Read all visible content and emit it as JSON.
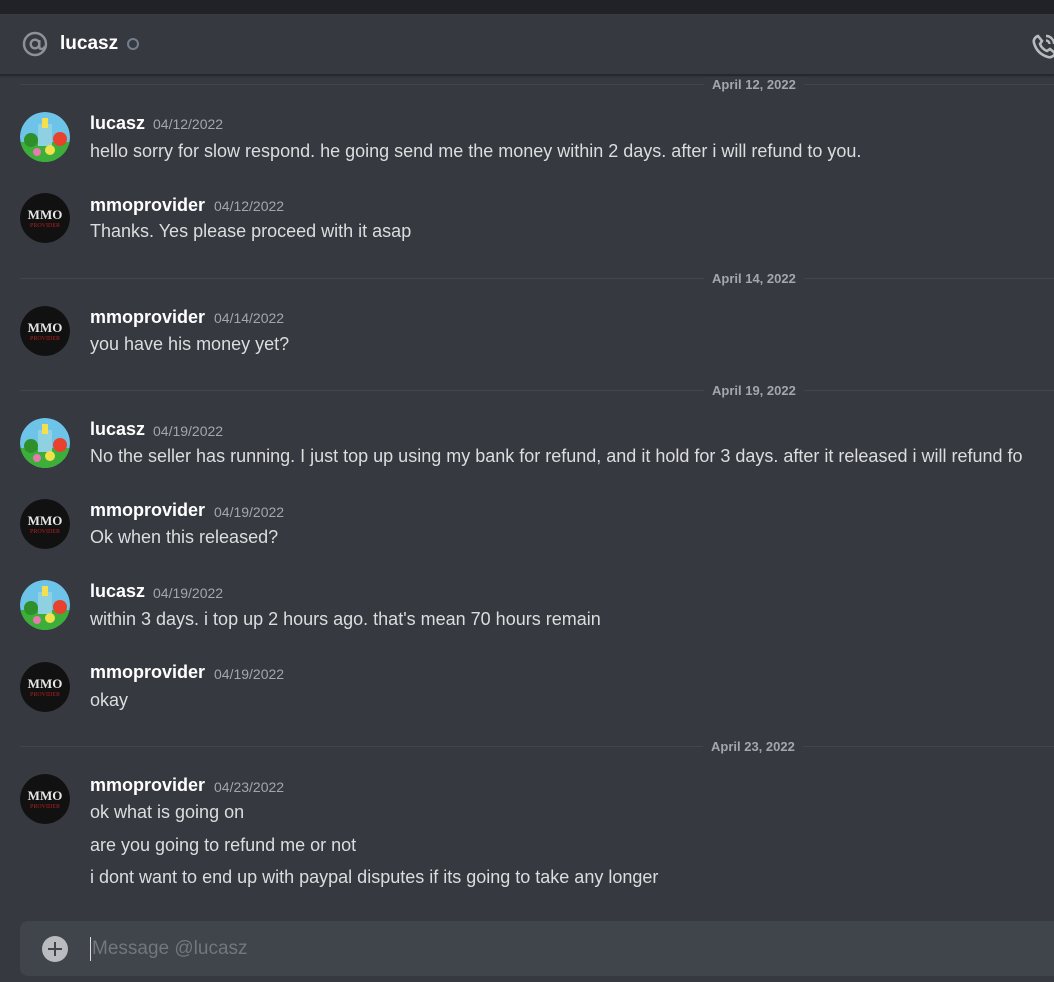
{
  "header": {
    "channel_name": "lucasz",
    "status": "offline"
  },
  "icons": {
    "at": "at-icon",
    "call": "phone-call-icon",
    "plus": "plus-circle-icon"
  },
  "colors": {
    "background": "#36393f",
    "header_text": "#ffffff",
    "timestamp": "#a3a6aa",
    "message_text": "#dcddde"
  },
  "dividers": [
    "April 12, 2022",
    "April 14, 2022",
    "April 19, 2022",
    "April 23, 2022"
  ],
  "messages": [
    {
      "author": "lucasz",
      "timestamp": "04/12/2022",
      "lines": [
        "hello sorry for slow respond. he going send me the money within 2 days. after i will refund to you."
      ]
    },
    {
      "author": "mmoprovider",
      "timestamp": "04/12/2022",
      "lines": [
        "Thanks. Yes please proceed with it asap"
      ]
    },
    {
      "author": "mmoprovider",
      "timestamp": "04/14/2022",
      "lines": [
        "you have his money yet?"
      ]
    },
    {
      "author": "lucasz",
      "timestamp": "04/19/2022",
      "lines": [
        "No the seller has running. I just top up using my bank for refund, and it hold for 3 days. after it released i will refund fo"
      ]
    },
    {
      "author": "mmoprovider",
      "timestamp": "04/19/2022",
      "lines": [
        "Ok when this released?"
      ]
    },
    {
      "author": "lucasz",
      "timestamp": "04/19/2022",
      "lines": [
        "within 3 days. i top up 2 hours ago. that's mean 70 hours remain"
      ]
    },
    {
      "author": "mmoprovider",
      "timestamp": "04/19/2022",
      "lines": [
        "okay"
      ]
    },
    {
      "author": "mmoprovider",
      "timestamp": "04/23/2022",
      "lines": [
        "ok what is going on",
        "are you going to refund me or not",
        "i dont want to end up with paypal disputes if its going to take any longer"
      ]
    }
  ],
  "composer": {
    "placeholder": "Message @lucasz"
  }
}
